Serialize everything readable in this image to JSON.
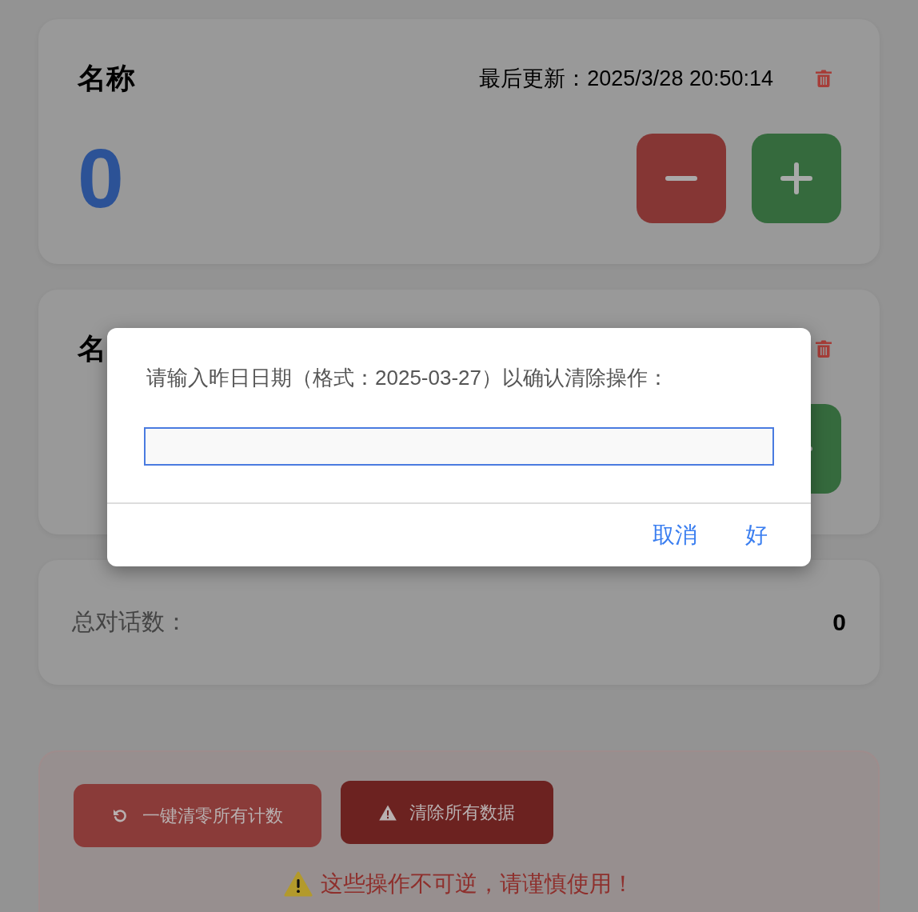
{
  "counters": [
    {
      "name": "名称",
      "last_updated": "最后更新：2025/3/28 20:50:14",
      "count": "0",
      "controls": [
        {
          "kind": "decrement"
        },
        {
          "kind": "increment"
        }
      ]
    },
    {
      "name": "名",
      "controls": [
        {
          "kind": "increment"
        }
      ]
    }
  ],
  "summary": {
    "label": "总对话数：",
    "value": "0"
  },
  "danger_zone": {
    "buttons": [
      {
        "kind": "reset",
        "label": "一键清零所有计数"
      },
      {
        "kind": "clear",
        "label": "清除所有数据"
      }
    ],
    "warning": "这些操作不可逆，请谨慎使用！"
  },
  "dialog": {
    "message": "请输入昨日日期（格式：2025-03-27）以确认清除操作：",
    "input": {
      "focused": true
    },
    "buttons": [
      "取消",
      "好"
    ]
  }
}
